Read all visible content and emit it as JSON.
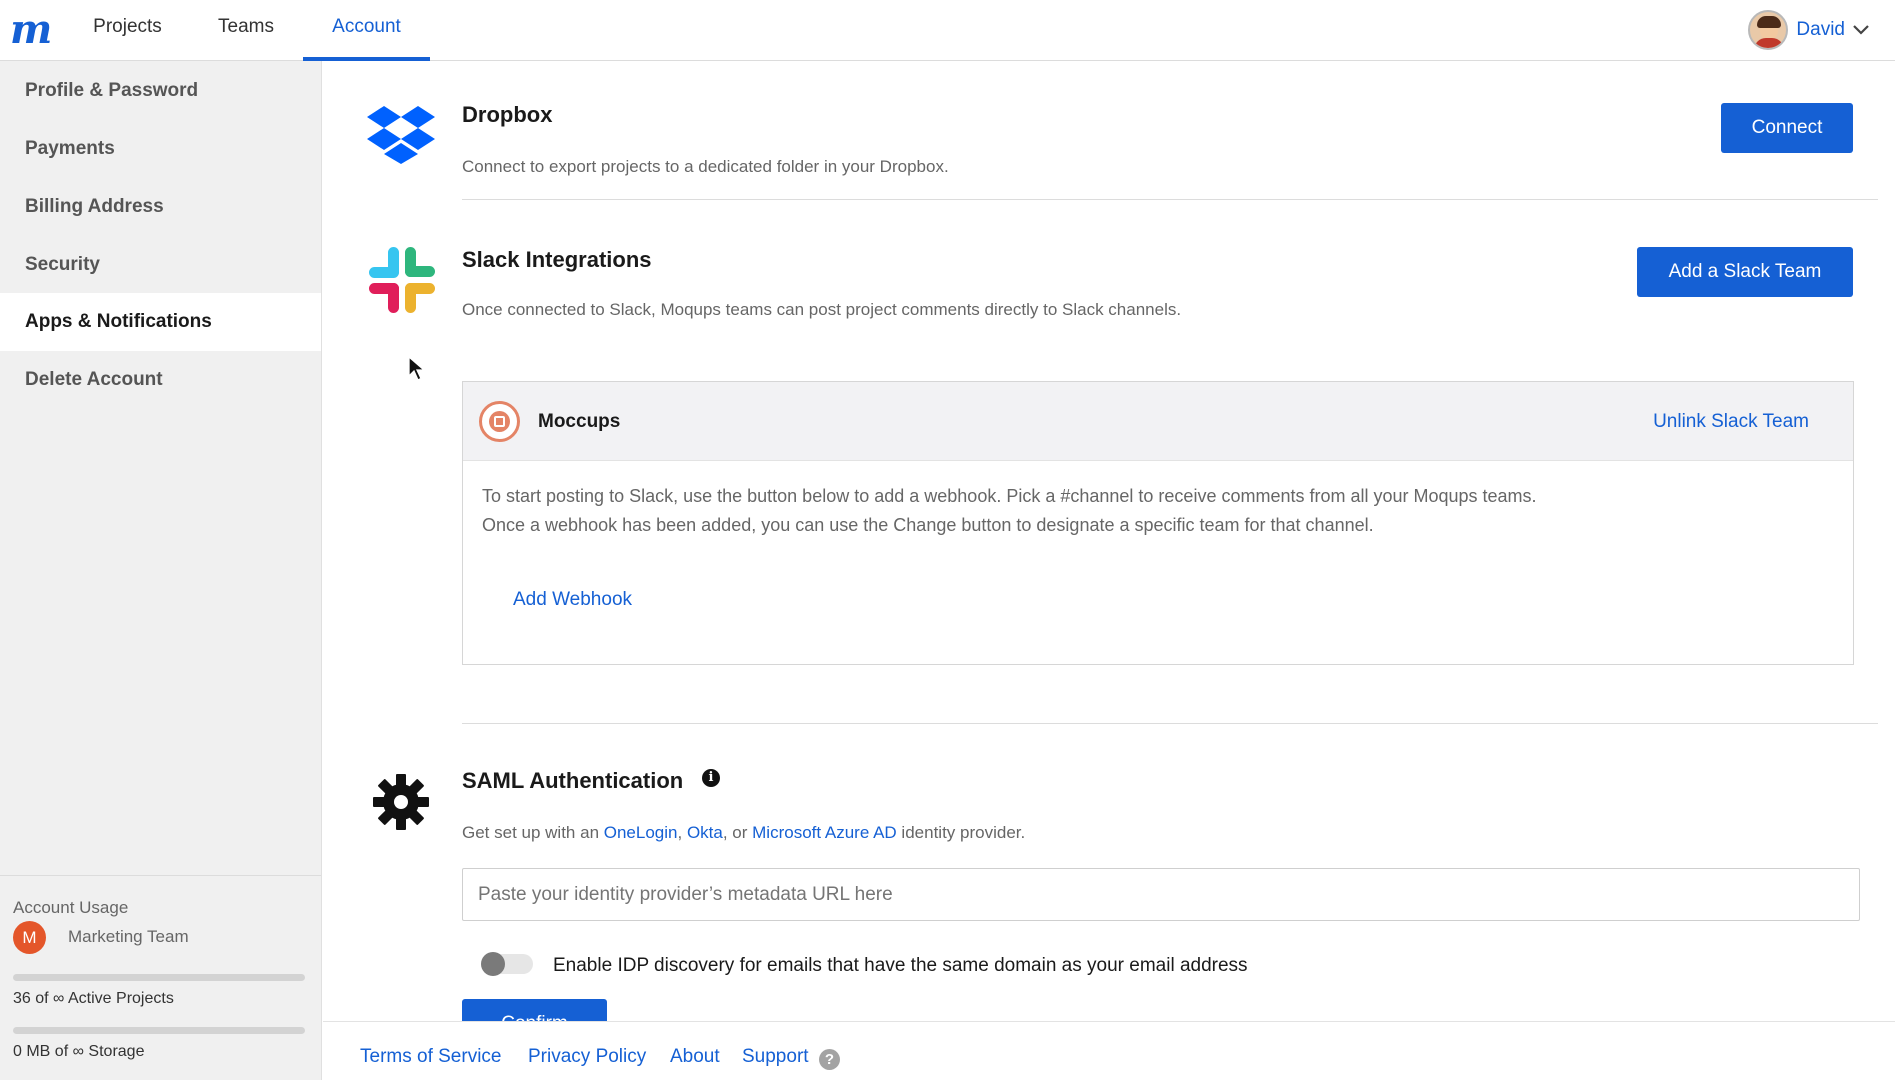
{
  "nav": {
    "logo": "m",
    "tabs": [
      {
        "label": "Projects"
      },
      {
        "label": "Teams"
      },
      {
        "label": "Account"
      }
    ],
    "user": {
      "name": "David"
    }
  },
  "sidebar": {
    "items": [
      {
        "label": "Profile & Password"
      },
      {
        "label": "Payments"
      },
      {
        "label": "Billing Address"
      },
      {
        "label": "Security"
      },
      {
        "label": "Apps & Notifications"
      },
      {
        "label": "Delete Account"
      }
    ],
    "active_index": 4,
    "usage": {
      "title": "Account Usage",
      "team_initial": "M",
      "team_name": "Marketing Team",
      "projects_text": "36 of ∞ Active Projects",
      "storage_text": "0 MB of ∞ Storage",
      "projects_fill": 0,
      "storage_fill": 0
    }
  },
  "dropbox": {
    "title": "Dropbox",
    "description": "Connect to export projects to a dedicated folder in your Dropbox.",
    "button": "Connect"
  },
  "slack": {
    "title": "Slack Integrations",
    "description": "Once connected to Slack, Moqups teams can post project comments directly to Slack channels.",
    "button": "Add a Slack Team",
    "team": {
      "name": "Moccups",
      "unlink": "Unlink Slack Team",
      "instructions_line1": "To start posting to Slack, use the button below to add a webhook. Pick a #channel to receive comments from all your Moqups teams.",
      "instructions_line2": "Once a webhook has been added, you can use the Change button to designate a specific team for that channel.",
      "add_webhook": "Add Webhook"
    }
  },
  "saml": {
    "title": "SAML Authentication",
    "info_icon": "i",
    "desc_prefix": "Get set up with an ",
    "provider1": "OneLogin",
    "sep1": ", ",
    "provider2": "Okta",
    "sep2": ", or ",
    "provider3": "Microsoft Azure AD",
    "desc_suffix": " identity provider.",
    "input_placeholder": "Paste your identity provider’s metadata URL here",
    "toggle_label": "Enable IDP discovery for emails that have the same domain as your email address",
    "toggle_on": false,
    "confirm_button": "Confirm"
  },
  "footer": {
    "links": [
      {
        "label": "Terms of Service"
      },
      {
        "label": "Privacy Policy"
      },
      {
        "label": "About"
      },
      {
        "label": "Support"
      }
    ],
    "help_icon": "?"
  },
  "colors": {
    "accent": "#1560d4",
    "sidebar_bg": "#f0f0f0",
    "slack_green": "#2eb67d",
    "slack_blue": "#36c5f0",
    "slack_red": "#e01e5a",
    "slack_yellow": "#ecb22e",
    "dropbox_blue": "#0061fe",
    "team_badge": "#e4562a"
  }
}
